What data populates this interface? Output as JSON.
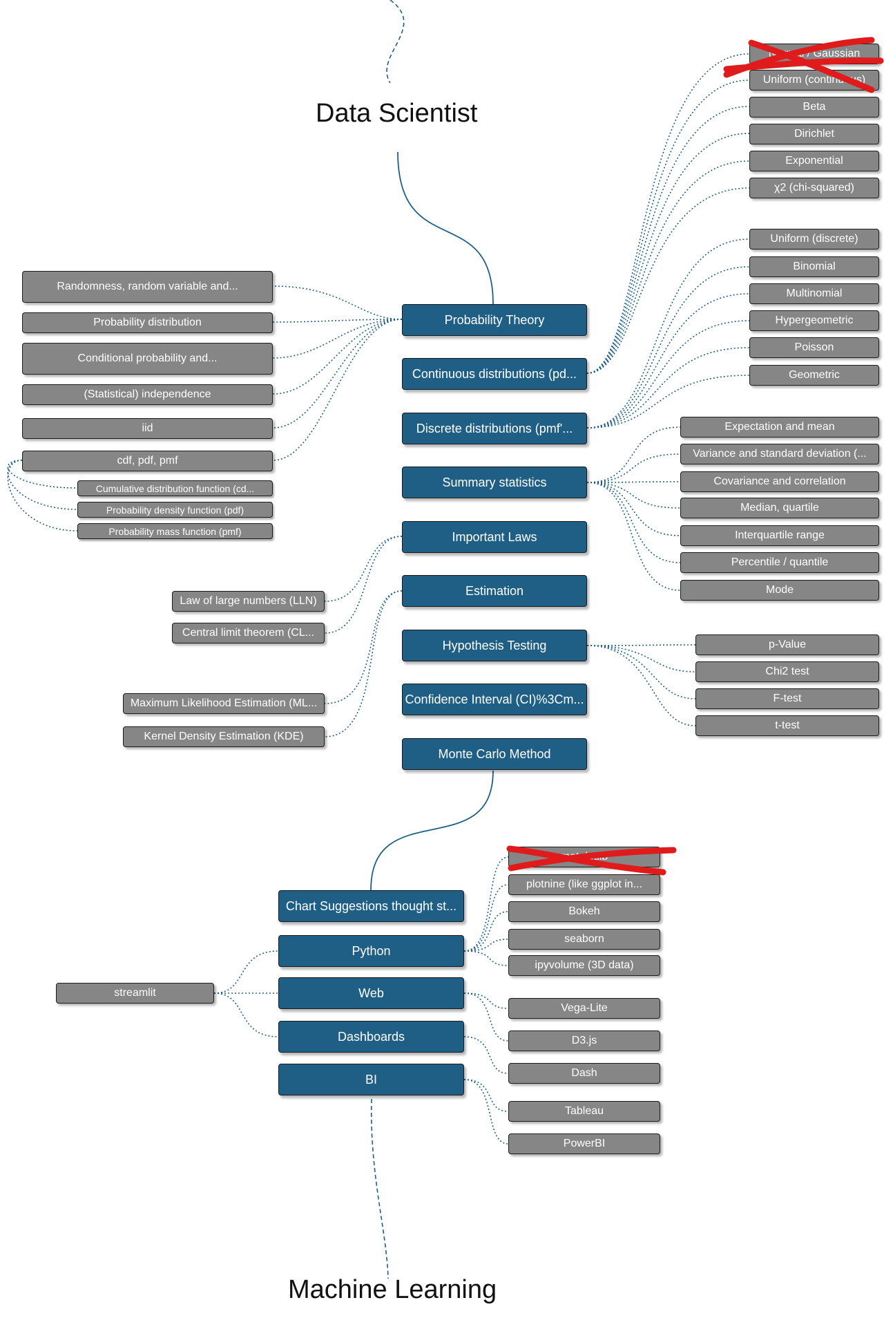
{
  "headings": {
    "top": "Data Scientist",
    "bottom": "Machine Learning"
  },
  "main_branches": [
    "Probability Theory",
    "Continuous distributions (pd...",
    "Discrete distributions (pmf'...",
    "Summary statistics",
    "Important Laws",
    "Estimation",
    "Hypothesis Testing",
    "Confidence Interval (CI)%3Cm...",
    "Monte Carlo Method"
  ],
  "probability_theory": {
    "items": [
      "Randomness, random variable and...",
      "Probability distribution",
      "Conditional probability and...",
      "(Statistical) independence",
      "iid",
      "cdf, pdf, pmf"
    ],
    "cdf_children": [
      "Cumulative distribution function (cd...",
      "Probability density function (pdf)",
      "Probability mass function (pmf)"
    ]
  },
  "continuous_distributions": {
    "crossed_out": [
      "Normal / Gaussian",
      "Uniform (continuous)"
    ],
    "items": [
      "Beta",
      "Dirichlet",
      "Exponential",
      "χ2 (chi-squared)"
    ]
  },
  "discrete_distributions": [
    "Uniform (discrete)",
    "Binomial",
    "Multinomial",
    "Hypergeometric",
    "Poisson",
    "Geometric"
  ],
  "summary_statistics": [
    "Expectation and mean",
    "Variance and standard deviation (...",
    "Covariance and correlation",
    "Median, quartile",
    "Interquartile range",
    "Percentile / quantile",
    "Mode"
  ],
  "important_laws": [
    "Law of large numbers (LLN)",
    "Central limit theorem (CL..."
  ],
  "estimation": [
    "Maximum Likelihood Estimation (ML...",
    "Kernel Density Estimation (KDE)"
  ],
  "hypothesis_testing": [
    "p-Value",
    "Chi2 test",
    "F-test",
    "t-test"
  ],
  "visualization": {
    "branches": [
      "Chart Suggestions thought st...",
      "Python",
      "Web",
      "Dashboards",
      "BI"
    ],
    "python": {
      "crossed_out": [
        "matplotlib"
      ],
      "items": [
        "plotnine (like ggplot in...",
        "Bokeh",
        "seaborn",
        "ipyvolume (3D data)"
      ]
    },
    "streamlit": "streamlit",
    "web": [
      "Vega-Lite",
      "D3.js"
    ],
    "dashboards": [
      "Dash"
    ],
    "bi": [
      "Tableau",
      "PowerBI"
    ]
  },
  "colors": {
    "main_node": "#1f5f86",
    "sub_node": "#868686",
    "connector": "#1f5f86",
    "cross_mark": "#e01b1b"
  }
}
